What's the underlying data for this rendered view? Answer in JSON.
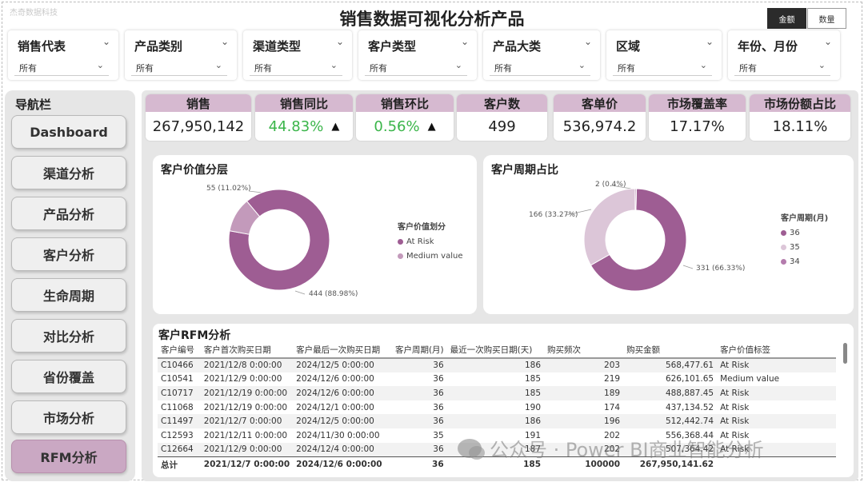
{
  "brand": "杰奇数据科技",
  "title": "销售数据可视化分析产品",
  "toggle": {
    "amount": "金额",
    "quantity": "数量"
  },
  "slicers": [
    {
      "label": "销售代表",
      "value": "所有"
    },
    {
      "label": "产品类别",
      "value": "所有"
    },
    {
      "label": "渠道类型",
      "value": "所有"
    },
    {
      "label": "客户类型",
      "value": "所有"
    },
    {
      "label": "产品大类",
      "value": "所有"
    },
    {
      "label": "区域",
      "value": "所有"
    },
    {
      "label": "年份、月份",
      "value": "所有"
    }
  ],
  "nav": {
    "title": "导航栏",
    "items": [
      "Dashboard",
      "渠道分析",
      "产品分析",
      "客户分析",
      "生命周期",
      "对比分析",
      "省份覆盖",
      "市场分析",
      "RFM分析"
    ],
    "active": "RFM分析"
  },
  "kpis": [
    {
      "label": "销售",
      "value": "267,950,142"
    },
    {
      "label": "销售同比",
      "value": "44.83%",
      "arrow": "▲"
    },
    {
      "label": "销售环比",
      "value": "0.56%",
      "arrow": "▲"
    },
    {
      "label": "客户数",
      "value": "499"
    },
    {
      "label": "客单价",
      "value": "536,974.2"
    },
    {
      "label": "市场覆盖率",
      "value": "17.17%"
    },
    {
      "label": "市场份额占比",
      "value": "18.11%"
    }
  ],
  "value_chart": {
    "title": "客户价值分层",
    "legend_title": "客户价值划分",
    "labels": {
      "at_risk": "444 (88.98%)",
      "medium": "55 (11.02%)"
    },
    "legend": [
      "At Risk",
      "Medium value"
    ],
    "colors": [
      "#9e5d93",
      "#c39abb"
    ],
    "chart_data": {
      "type": "pie",
      "categories": [
        "At Risk",
        "Medium value"
      ],
      "values": [
        444,
        55
      ]
    }
  },
  "cycle_chart": {
    "title": "客户周期占比",
    "legend_title": "客户周期(月)",
    "labels": {
      "c36": "331 (66.33%)",
      "c35": "166 (33.27%)",
      "c34": "2 (0.4%)"
    },
    "legend": [
      "36",
      "35",
      "34"
    ],
    "colors": [
      "#9e5d93",
      "#dcc6d8",
      "#b47cad"
    ],
    "chart_data": {
      "type": "pie",
      "categories": [
        "36",
        "35",
        "34"
      ],
      "values": [
        331,
        166,
        2
      ]
    }
  },
  "rfm": {
    "title": "客户RFM分析",
    "columns": [
      "客户编号",
      "客户首次购买日期",
      "客户最后一次购买日期",
      "客户周期(月)",
      "最近一次购买日期(天)",
      "购买频次",
      "购买金额",
      "客户价值标签"
    ],
    "rows": [
      [
        "C10466",
        "2021/12/8 0:00:00",
        "2024/12/5 0:00:00",
        "36",
        "186",
        "203",
        "568,477.61",
        "At Risk"
      ],
      [
        "C10541",
        "2021/12/9 0:00:00",
        "2024/12/6 0:00:00",
        "36",
        "185",
        "219",
        "626,101.65",
        "Medium value"
      ],
      [
        "C10717",
        "2021/12/19 0:00:00",
        "2024/12/6 0:00:00",
        "36",
        "185",
        "189",
        "488,887.45",
        "At Risk"
      ],
      [
        "C11068",
        "2021/12/19 0:00:00",
        "2024/12/1 0:00:00",
        "36",
        "190",
        "174",
        "437,134.52",
        "At Risk"
      ],
      [
        "C11497",
        "2021/12/7 0:00:00",
        "2024/12/5 0:00:00",
        "36",
        "186",
        "196",
        "512,442.74",
        "At Risk"
      ],
      [
        "C12593",
        "2021/12/11 0:00:00",
        "2024/11/30 0:00:00",
        "35",
        "191",
        "202",
        "556,368.44",
        "At Risk"
      ],
      [
        "C12664",
        "2021/12/9 0:00:00",
        "2024/12/4 0:00:00",
        "36",
        "187",
        "202",
        "507,364.42",
        "At Risk"
      ]
    ],
    "total": [
      "总计",
      "2021/12/7 0:00:00",
      "2024/12/6 0:00:00",
      "36",
      "185",
      "100000",
      "267,950,141.62",
      ""
    ]
  },
  "watermark": "公众号 · Power BI商业智能分析"
}
